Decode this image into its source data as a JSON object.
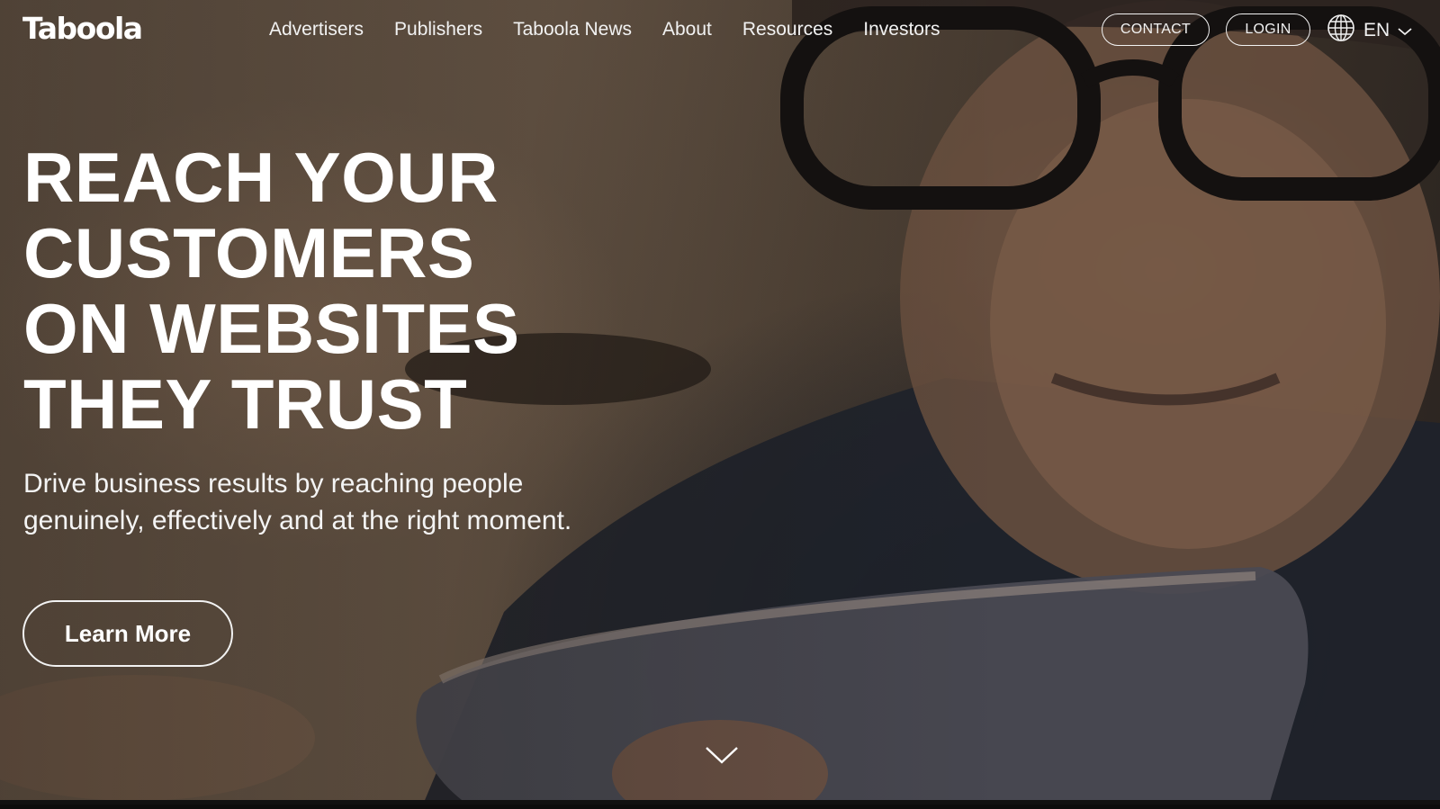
{
  "brand": {
    "logo_text": "Taboola"
  },
  "nav": {
    "items": [
      {
        "label": "Advertisers"
      },
      {
        "label": "Publishers"
      },
      {
        "label": "Taboola News"
      },
      {
        "label": "About"
      },
      {
        "label": "Resources"
      },
      {
        "label": "Investors"
      }
    ]
  },
  "header_actions": {
    "contact_label": "CONTACT",
    "login_label": "LOGIN",
    "language": "EN"
  },
  "hero": {
    "headline_lines": [
      "REACH YOUR",
      "CUSTOMERS",
      "ON WEBSITES",
      "THEY TRUST"
    ],
    "subtext_lines": [
      "Drive business results by reaching people",
      "genuinely, effectively and at the right moment."
    ],
    "cta_label": "Learn More"
  },
  "icons": {
    "language": "globe-icon",
    "language_dropdown": "chevron-down-icon",
    "scroll": "chevron-down-icon"
  },
  "colors": {
    "text": "#ffffff",
    "background_dark": "#2a2420",
    "background_warm": "#6f5e4e"
  }
}
